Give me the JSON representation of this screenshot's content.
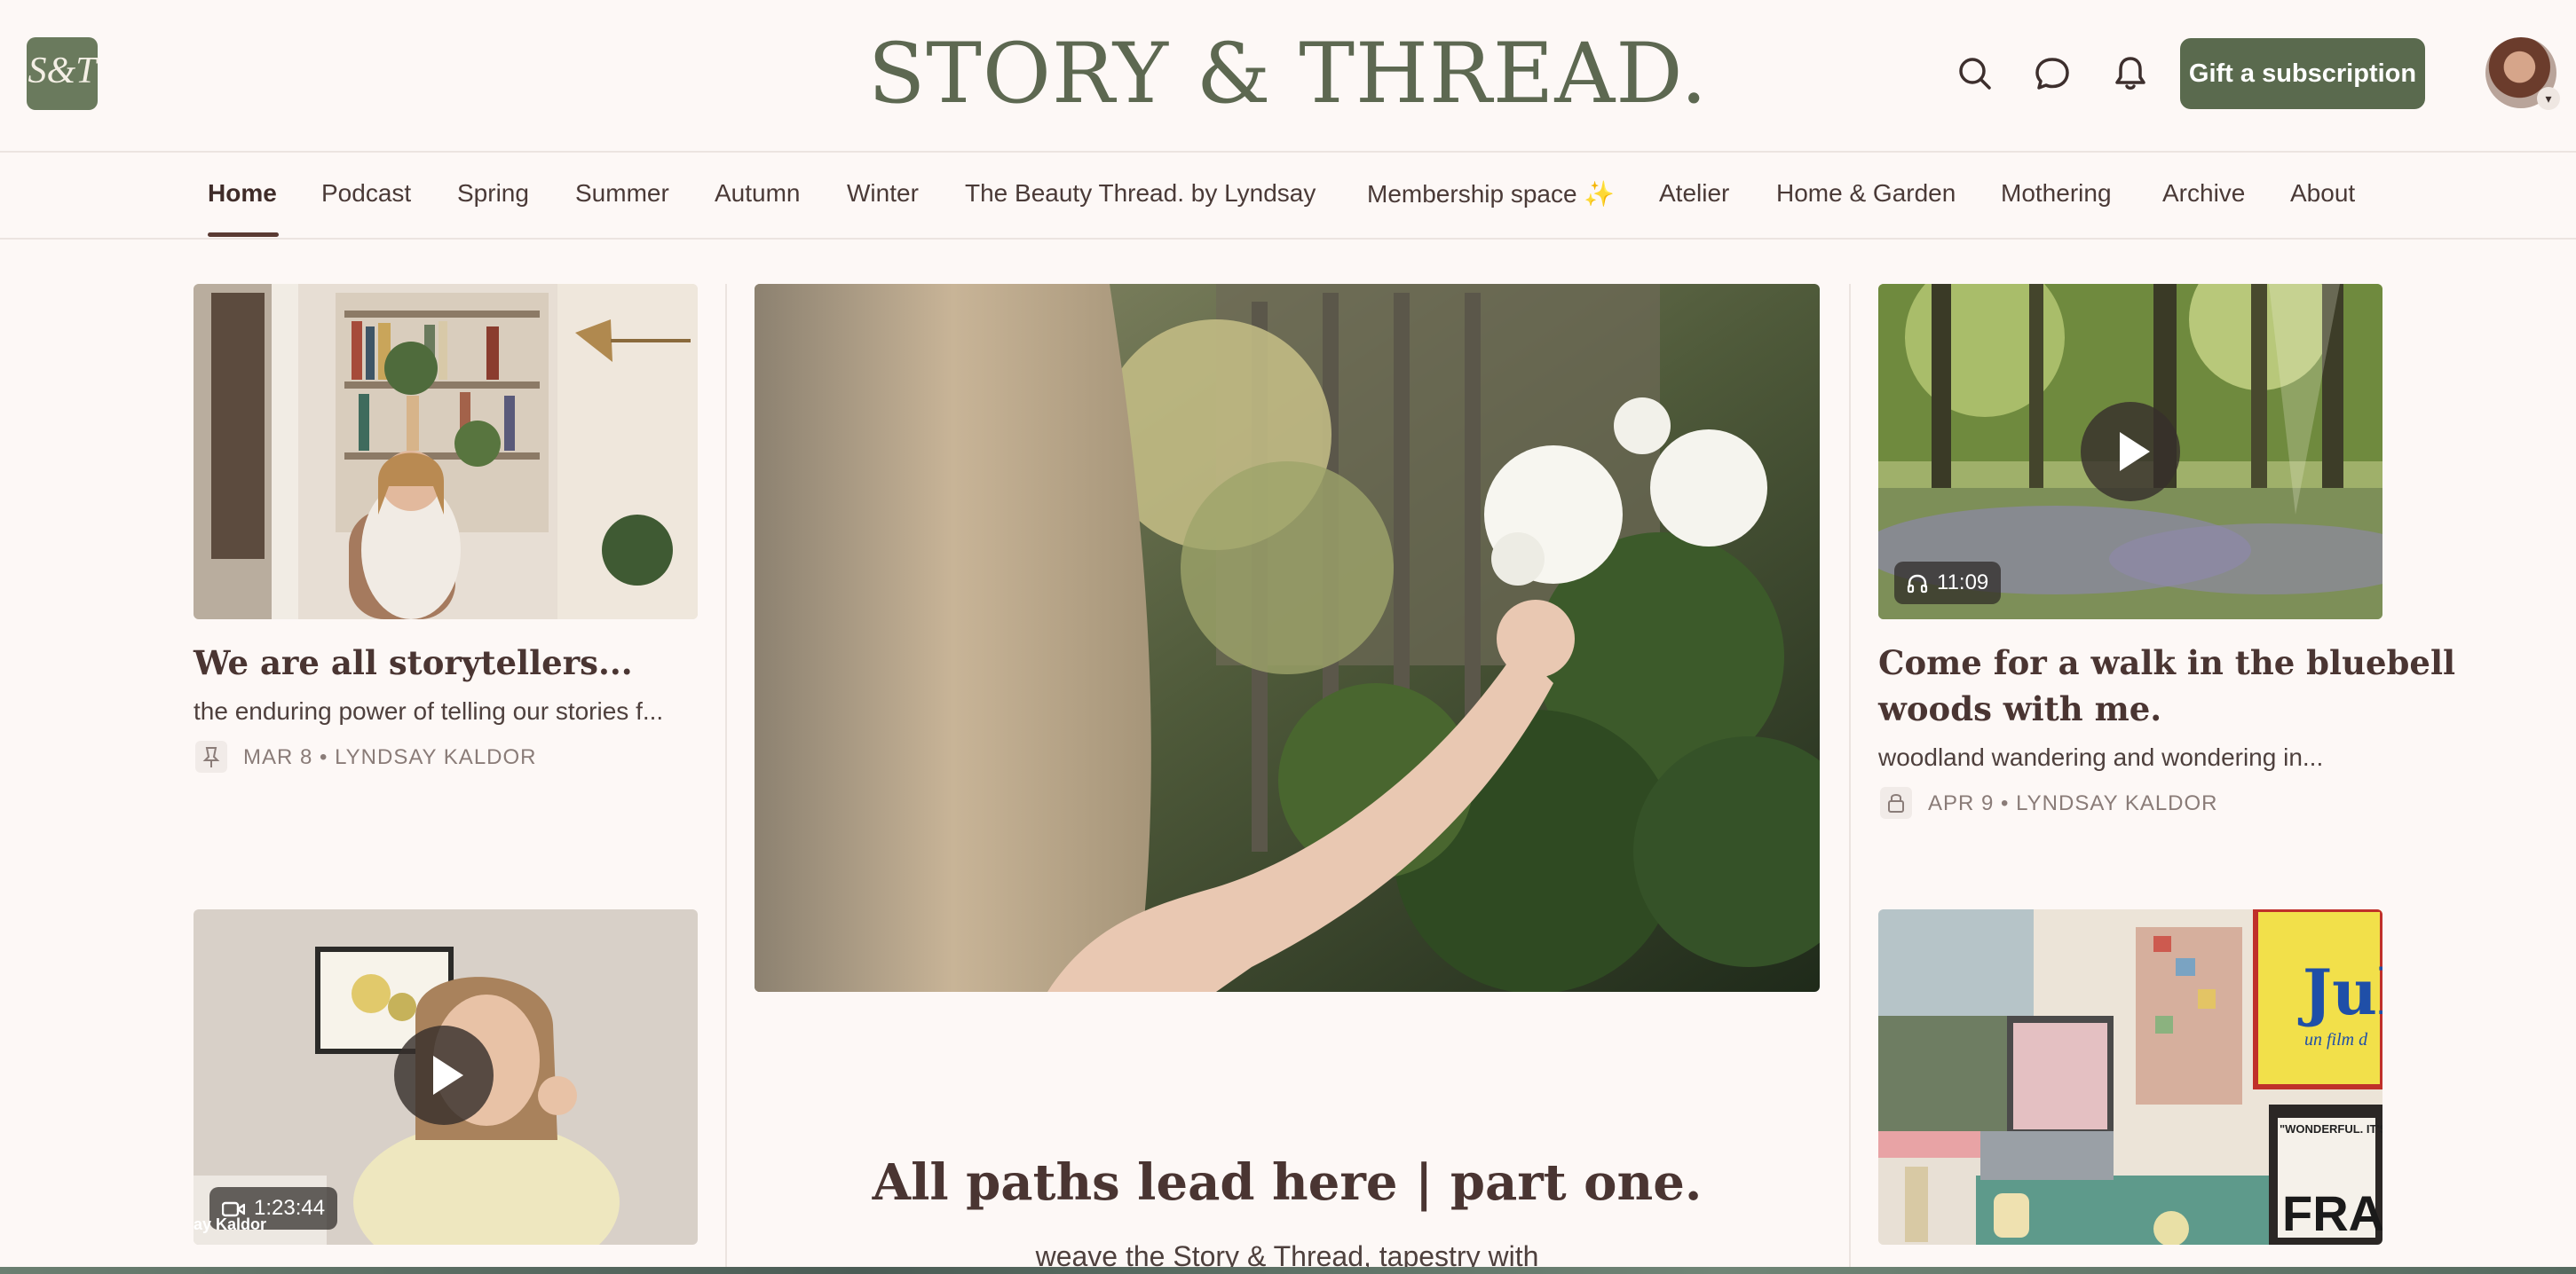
{
  "header": {
    "logo_text": "S&T",
    "site_title": "STORY & THREAD.",
    "gift_button": "Gift a subscription",
    "icons": [
      "search-icon",
      "chat-icon",
      "bell-icon"
    ]
  },
  "nav": {
    "items": [
      "Home",
      "Podcast",
      "Spring",
      "Summer",
      "Autumn",
      "Winter",
      "The Beauty Thread. by Lyndsay",
      "Membership space ✨",
      "Atelier",
      "Home & Garden",
      "Mothering",
      "Archive",
      "About"
    ],
    "active": "Home"
  },
  "cards": {
    "left_top": {
      "title": "We are all storytellers...",
      "subtitle": "the enduring power of telling our stories f...",
      "meta": "MAR 8 • LYNDSAY KALDOR",
      "meta_icon": "pin-icon"
    },
    "left_bottom": {
      "duration": "1:23:44",
      "duration_icon": "video-icon",
      "watermark": "ay Kaldor"
    },
    "feature": {
      "title": "All paths lead here | part one.",
      "subtitle": "weave the Story & Thread, tapestry with"
    },
    "right_top": {
      "title_line1": "Come for a walk in the bluebell",
      "title_line2": "woods with me.",
      "subtitle": "woodland wandering and wondering in...",
      "meta": "APR 9 • LYNDSAY KALDOR",
      "meta_icon": "lock-icon",
      "duration": "11:09",
      "duration_icon": "headphones-icon"
    },
    "right_bottom": {
      "poster_text_1": "Jul",
      "poster_text_2": "un film d",
      "poster_text_3": "FRAN",
      "poster_text_4": "\"WONDERFUL. IT'S"
    }
  },
  "colors": {
    "background": "#fdf8f6",
    "brand_green": "#5a6a4e",
    "title_green": "#5d6851",
    "text_brown": "#4a3532",
    "meta_grey": "#8a7c78"
  }
}
